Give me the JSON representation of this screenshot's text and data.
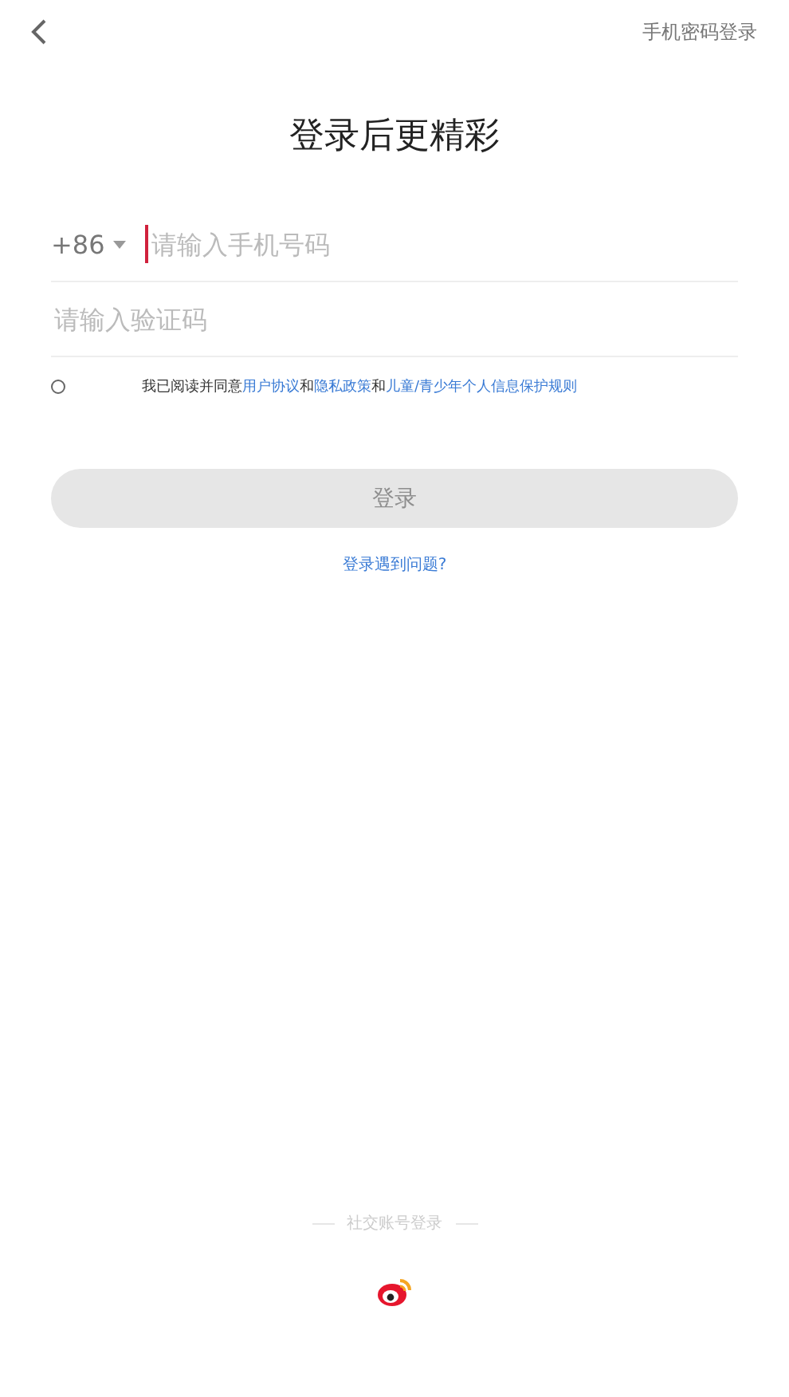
{
  "header": {
    "switch_link": "手机密码登录"
  },
  "title": "登录后更精彩",
  "phone": {
    "country_code": "+86",
    "placeholder": "请输入手机号码",
    "focused": true
  },
  "code": {
    "placeholder": "请输入验证码"
  },
  "agreement": {
    "checked": false,
    "parts": [
      {
        "kind": "text",
        "text": "我已阅读并同意"
      },
      {
        "kind": "link",
        "text": "用户协议"
      },
      {
        "kind": "text",
        "text": "和"
      },
      {
        "kind": "link",
        "text": "隐私政策"
      },
      {
        "kind": "text",
        "text": "和"
      },
      {
        "kind": "link",
        "text": "儿童/青少年个人信息保护规则"
      }
    ]
  },
  "login_button": {
    "label": "登录",
    "disabled": true
  },
  "help_link": "登录遇到问题?",
  "social": {
    "heading": "社交账号登录"
  }
}
